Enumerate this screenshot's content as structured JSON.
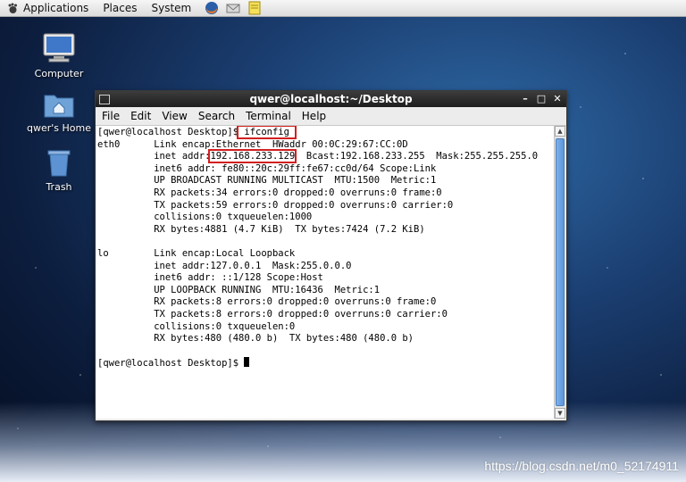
{
  "top_panel": {
    "menus": [
      "Applications",
      "Places",
      "System"
    ],
    "launchers": [
      "firefox-icon",
      "mail-icon",
      "notes-icon"
    ]
  },
  "desktop": {
    "icons": [
      {
        "label": "Computer",
        "icon": "computer-icon"
      },
      {
        "label": "qwer's Home",
        "icon": "home-folder-icon"
      },
      {
        "label": "Trash",
        "icon": "trash-icon"
      }
    ]
  },
  "terminal": {
    "title": "qwer@localhost:~/Desktop",
    "menu": [
      "File",
      "Edit",
      "View",
      "Search",
      "Terminal",
      "Help"
    ],
    "prompt": "[qwer@localhost Desktop]$",
    "command": "ifconfig",
    "eth0_iface": "eth0",
    "eth0_line1": "      Link encap:Ethernet  HWaddr 00:0C:29:67:CC:0D",
    "eth0_inet_prefix": "          inet addr:",
    "eth0_ip": "192.168.233.129",
    "eth0_inet_suffix": "  Bcast:192.168.233.255  Mask:255.255.255.0",
    "eth0_rest": "          inet6 addr: fe80::20c:29ff:fe67:cc0d/64 Scope:Link\n          UP BROADCAST RUNNING MULTICAST  MTU:1500  Metric:1\n          RX packets:34 errors:0 dropped:0 overruns:0 frame:0\n          TX packets:59 errors:0 dropped:0 overruns:0 carrier:0\n          collisions:0 txqueuelen:1000\n          RX bytes:4881 (4.7 KiB)  TX bytes:7424 (7.2 KiB)\n\nlo        Link encap:Local Loopback\n          inet addr:127.0.0.1  Mask:255.0.0.0\n          inet6 addr: ::1/128 Scope:Host\n          UP LOOPBACK RUNNING  MTU:16436  Metric:1\n          RX packets:8 errors:0 dropped:0 overruns:0 frame:0\n          TX packets:8 errors:0 dropped:0 overruns:0 carrier:0\n          collisions:0 txqueuelen:0\n          RX bytes:480 (480.0 b)  TX bytes:480 (480.0 b)\n",
    "final_prompt": "[qwer@localhost Desktop]$ "
  },
  "watermark": "https://blog.csdn.net/m0_52174911",
  "colors": {
    "highlight": "#d21f1f",
    "scroll_thumb": "#5b96dd"
  }
}
